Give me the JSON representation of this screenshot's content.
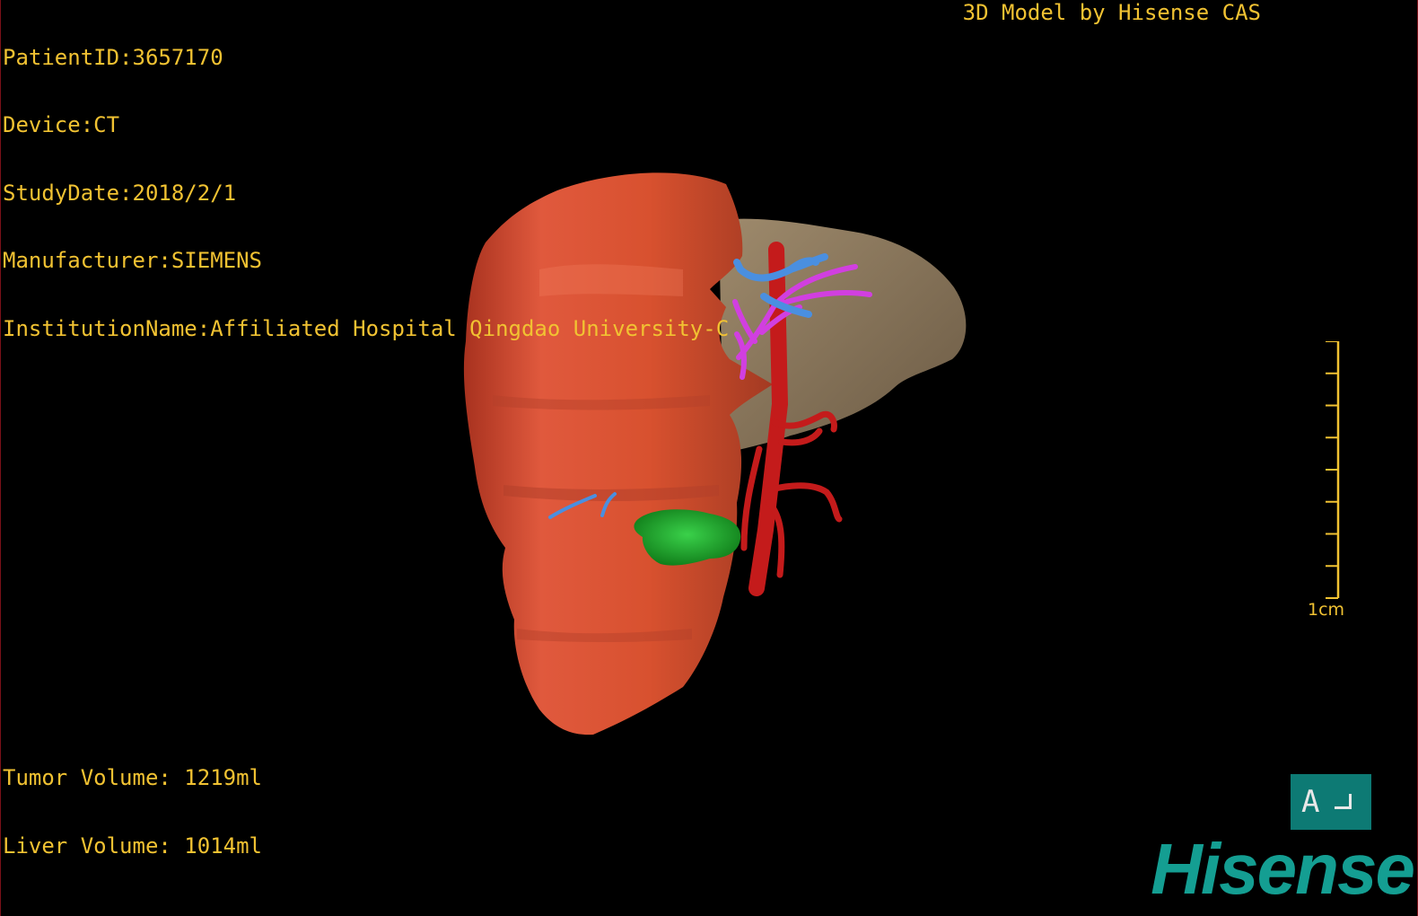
{
  "info": {
    "patient_id": "PatientID:3657170",
    "device": "Device:CT",
    "study_date": "StudyDate:2018/2/1",
    "manufacturer": "Manufacturer:SIEMENS",
    "institution": "InstitutionName:Affiliated Hospital Qingdao University-C"
  },
  "credit": "3D Model by Hisense CAS",
  "volumes": {
    "tumor": "Tumor Volume: 1219ml",
    "liver": "Liver Volume: 1014ml"
  },
  "scale": {
    "label": "1cm",
    "ticks": 9
  },
  "orientation": {
    "label": "A"
  },
  "logo": "Hisense",
  "colors": {
    "overlay_text": "#f1c232",
    "tumor": "#d9533a",
    "liver": "#8f7a5e",
    "artery": "#c41b1b",
    "portal_vein": "#d13fe0",
    "hepatic_vein": "#4a8fe0",
    "lesion": "#1fa82a",
    "logo": "#149e92",
    "orientation_bg": "#0d7a74"
  }
}
